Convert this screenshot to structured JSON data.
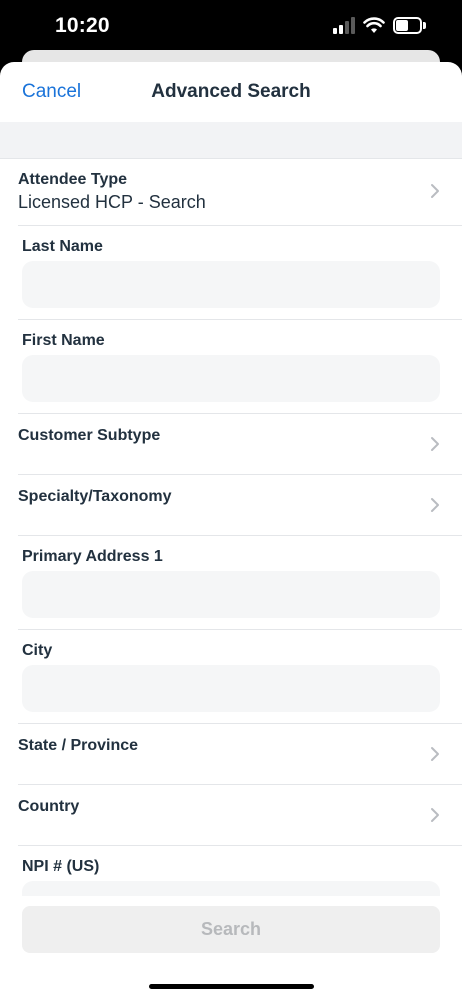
{
  "status_bar": {
    "time": "10:20",
    "signal_icon": "cellular-signal-icon",
    "wifi_icon": "wifi-icon",
    "battery_icon": "battery-icon"
  },
  "header": {
    "cancel_label": "Cancel",
    "title": "Advanced Search"
  },
  "form": {
    "attendee_type": {
      "label": "Attendee Type",
      "value": "Licensed HCP - Search"
    },
    "last_name": {
      "label": "Last Name",
      "value": ""
    },
    "first_name": {
      "label": "First Name",
      "value": ""
    },
    "customer_subtype": {
      "label": "Customer Subtype"
    },
    "specialty": {
      "label": "Specialty/Taxonomy"
    },
    "primary_address": {
      "label": "Primary Address 1",
      "value": ""
    },
    "city": {
      "label": "City",
      "value": ""
    },
    "state": {
      "label": "State / Province"
    },
    "country": {
      "label": "Country"
    },
    "npi": {
      "label": "NPI # (US)",
      "value": ""
    }
  },
  "footer": {
    "search_label": "Search"
  },
  "colors": {
    "accent": "#1a73d9",
    "text": "#22313f",
    "field_bg": "#f5f6f7",
    "disabled_button_bg": "#efefef",
    "disabled_button_text": "#b7b9bc"
  }
}
